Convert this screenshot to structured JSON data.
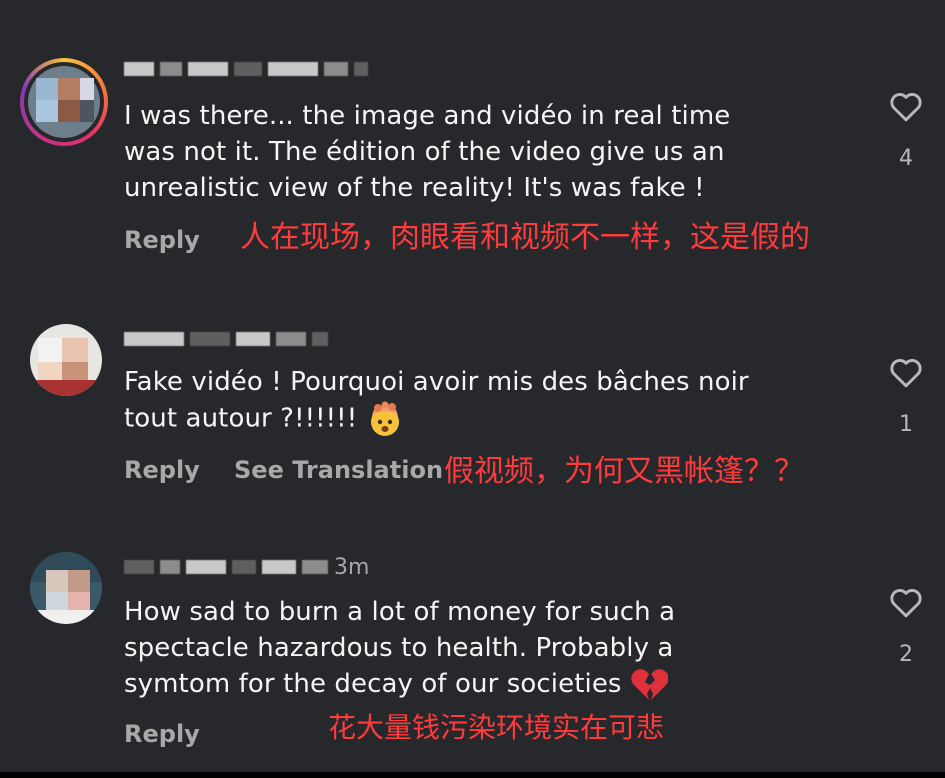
{
  "comments": [
    {
      "text_lines": [
        "I was there... the image and vidéo in real time",
        "was not it. The édition of the video give us an",
        "unrealistic view of the reality! It's was fake !"
      ],
      "reply_label": "Reply",
      "like_count": "4",
      "annotation": "人在现场，肉眼看和视频不一样，这是假的"
    },
    {
      "text_lines": [
        "Fake vidéo ! Pourquoi avoir mis des bâches noir",
        "tout autour ?!!!!!!"
      ],
      "emoji_icon": "exploding-head-emoji",
      "reply_label": "Reply",
      "translate_label": "See Translation",
      "like_count": "1",
      "annotation": "假视频，为何又黑帐篷？？"
    },
    {
      "username_suffix": "3m",
      "text_lines": [
        "How sad to burn a lot of money for such a",
        "spectacle hazardous to health. Probably a",
        "symtom for the decay of our societies"
      ],
      "emoji_icon": "broken-heart-emoji",
      "reply_label": "Reply",
      "like_count": "2",
      "annotation": "花大量钱污染环境实在可悲"
    }
  ],
  "colors": {
    "background": "#26282c",
    "text": "#f5f5f5",
    "muted": "#a8a8a8",
    "annotation": "#ff3b3b",
    "broken_heart": "#e0303c"
  },
  "icons": [
    "heart-outline-icon",
    "avatar"
  ]
}
